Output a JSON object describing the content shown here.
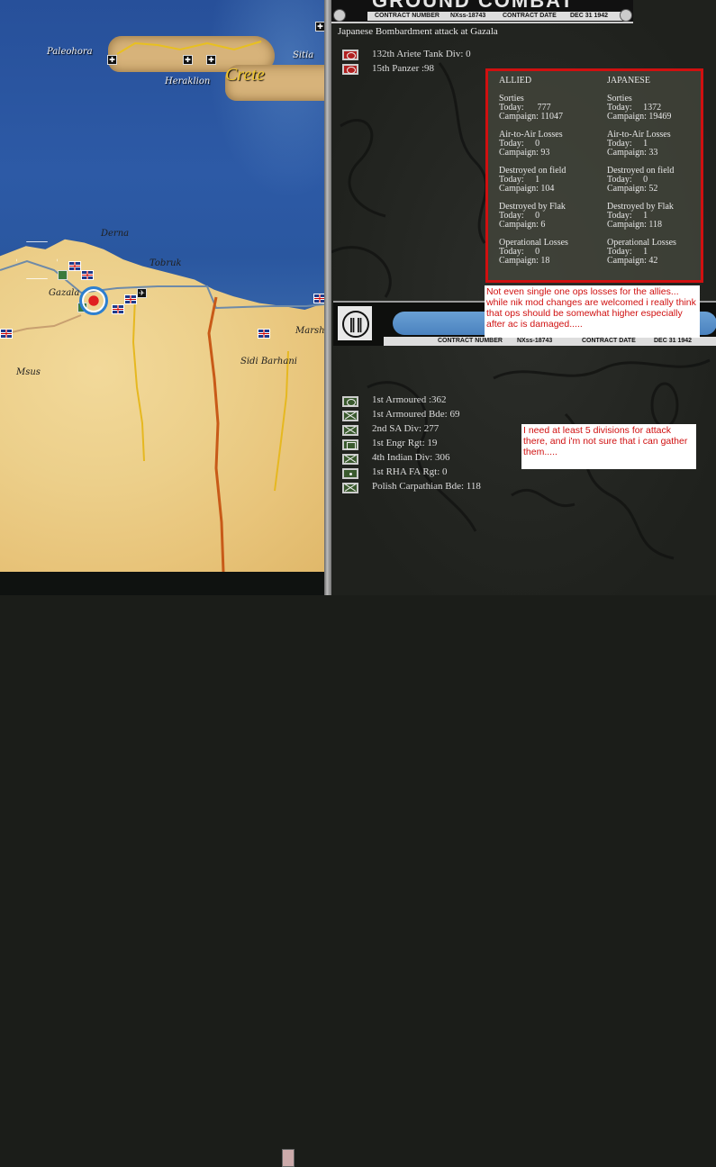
{
  "map": {
    "labels": [
      "Paleohora",
      "Heraklion",
      "Crete",
      "Sitia",
      "Derna",
      "Tobruk",
      "Gazala",
      "Msus",
      "Sidi Barhani",
      "Marsh"
    ]
  },
  "banner": {
    "title": "GROUND COMBAT",
    "contract_number_label": "CONTRACT NUMBER",
    "contract_number": "NXss-18743",
    "contract_date_label": "CONTRACT DATE",
    "contract_date": "DEC 31 1942"
  },
  "combat": {
    "title": "Japanese Bombardment attack at Gazala",
    "attacker_units": [
      {
        "name": "132th Ariete Tank Div: 0",
        "icon": "red-armor-icon"
      },
      {
        "name": "15th Panzer :98",
        "icon": "red-armor-icon"
      }
    ],
    "defender_units": [
      {
        "name": "1st Armoured :362",
        "icon": "green-armor-icon"
      },
      {
        "name": "1st Armoured Bde: 69",
        "icon": "green-infantry-icon"
      },
      {
        "name": "2nd SA Div: 277",
        "icon": "green-infantry-icon"
      },
      {
        "name": "1st Engr Rgt: 19",
        "icon": "green-engineer-icon"
      },
      {
        "name": "4th Indian Div: 306",
        "icon": "green-infantry-icon"
      },
      {
        "name": "1st RHA FA Rgt: 0",
        "icon": "green-artillery-icon"
      },
      {
        "name": "Polish Carpathian Bde: 118",
        "icon": "green-infantry-icon"
      }
    ]
  },
  "stats": {
    "allied": {
      "header": "ALLIED",
      "blocks": [
        {
          "label": "Sorties",
          "l1": "Today:      777",
          "l2": "Campaign: 11047"
        },
        {
          "label": "Air-to-Air Losses",
          "l1": "Today:     0",
          "l2": "Campaign: 93"
        },
        {
          "label": "Destroyed on field",
          "l1": "Today:     1",
          "l2": "Campaign: 104"
        },
        {
          "label": "Destroyed by Flak",
          "l1": "Today:     0",
          "l2": "Campaign: 6"
        },
        {
          "label": "Operational Losses",
          "l1": "Today:     0",
          "l2": "Campaign: 18"
        }
      ]
    },
    "japanese": {
      "header": "JAPANESE",
      "blocks": [
        {
          "label": "Sorties",
          "l1": "Today:     1372",
          "l2": "Campaign: 19469"
        },
        {
          "label": "Air-to-Air Losses",
          "l1": "Today:     1",
          "l2": "Campaign: 33"
        },
        {
          "label": "Destroyed on field",
          "l1": "Today:     0",
          "l2": "Campaign: 52"
        },
        {
          "label": "Destroyed by Flak",
          "l1": "Today:     1",
          "l2": "Campaign: 118"
        },
        {
          "label": "Operational Losses",
          "l1": "Today:     1",
          "l2": "Campaign: 42"
        }
      ]
    }
  },
  "comments": {
    "c1": "Not even single one ops losses for the allies... while nik mod changes are welcomed i really think that ops should be somewhat higher especially after ac is damaged.....",
    "c2": "I need at least 5 divisions for attack there, and i'm not sure that i can gather them....."
  },
  "colors": {
    "highlight_border": "#d01010",
    "comment_text": "#d01010"
  }
}
